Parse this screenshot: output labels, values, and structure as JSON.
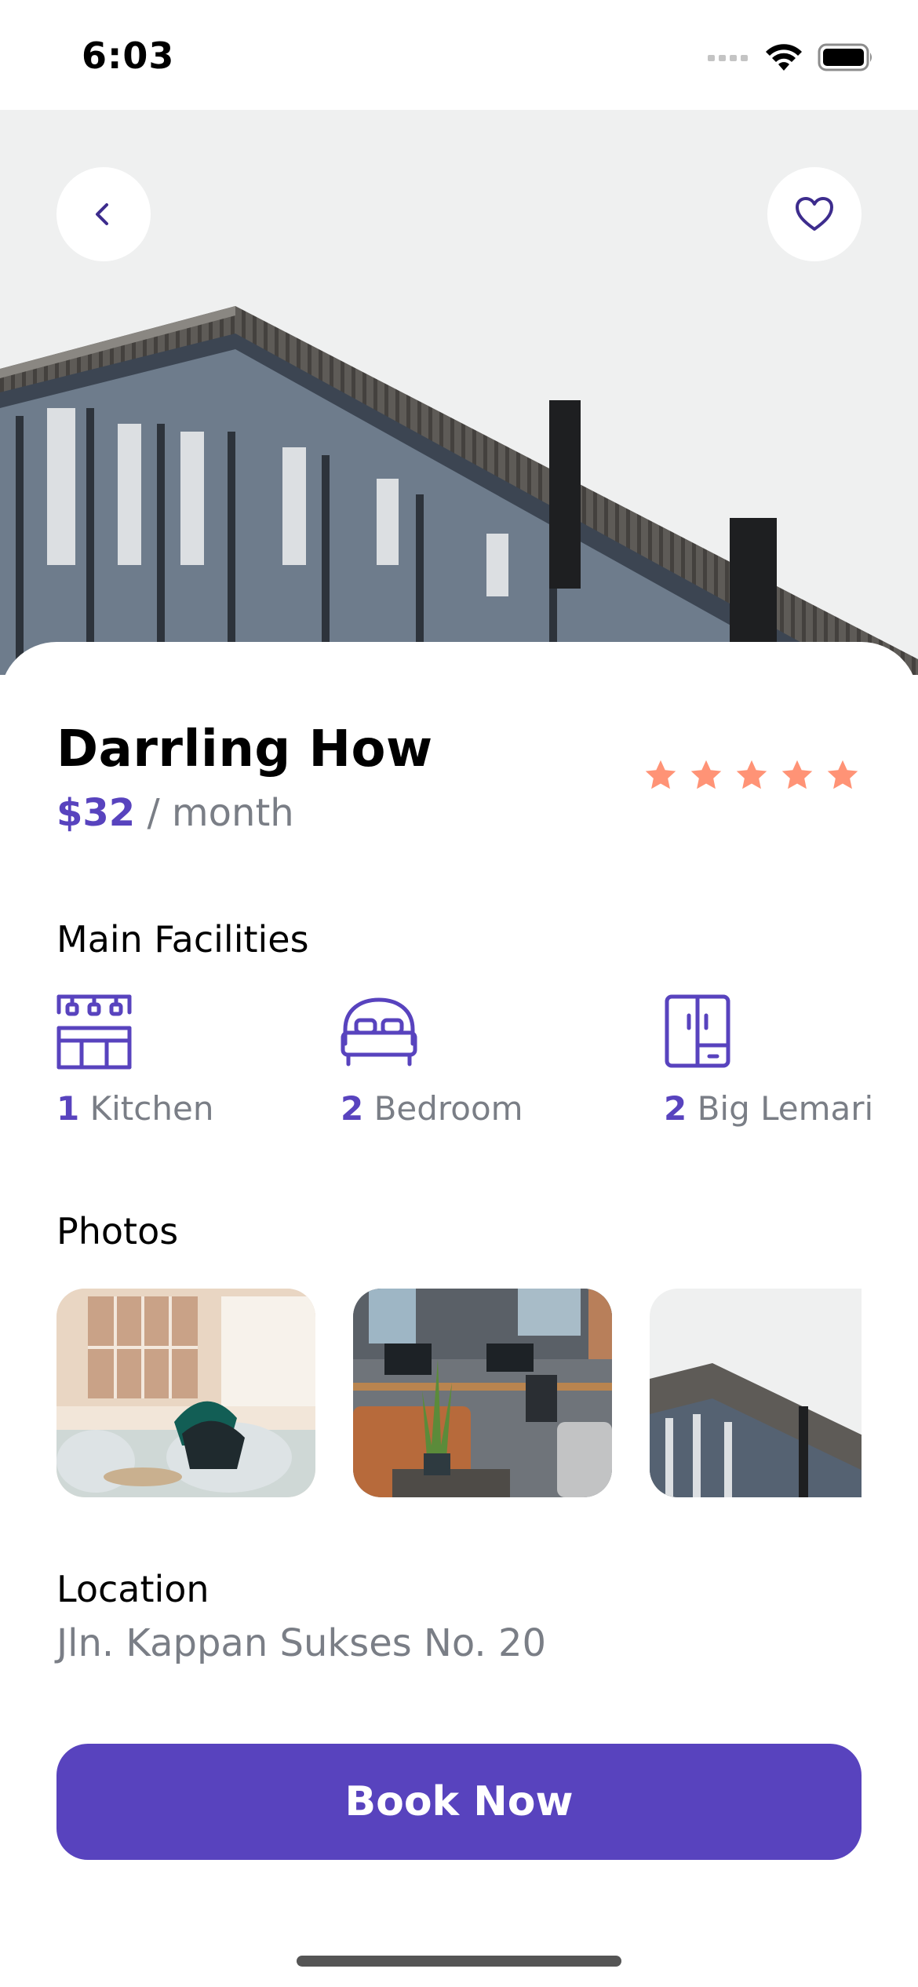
{
  "status_bar": {
    "time": "6:03"
  },
  "property": {
    "name": "Darrling How",
    "price": "$32",
    "price_period": " / month",
    "rating": 5,
    "rating_max": 5
  },
  "facilities": {
    "title": "Main Facilities",
    "items": [
      {
        "count": "1",
        "label": " Kitchen",
        "icon": "kitchen-icon"
      },
      {
        "count": "2",
        "label": " Bedroom",
        "icon": "bed-icon"
      },
      {
        "count": "2",
        "label": " Big Lemari",
        "icon": "wardrobe-icon"
      }
    ]
  },
  "photos": {
    "title": "Photos"
  },
  "location": {
    "title": "Location",
    "address": "Jln. Kappan Sukses No. 20"
  },
  "actions": {
    "book": "Book Now"
  },
  "colors": {
    "primary": "#5843BE",
    "star": "#FF9376",
    "muted": "#7A7E86"
  }
}
